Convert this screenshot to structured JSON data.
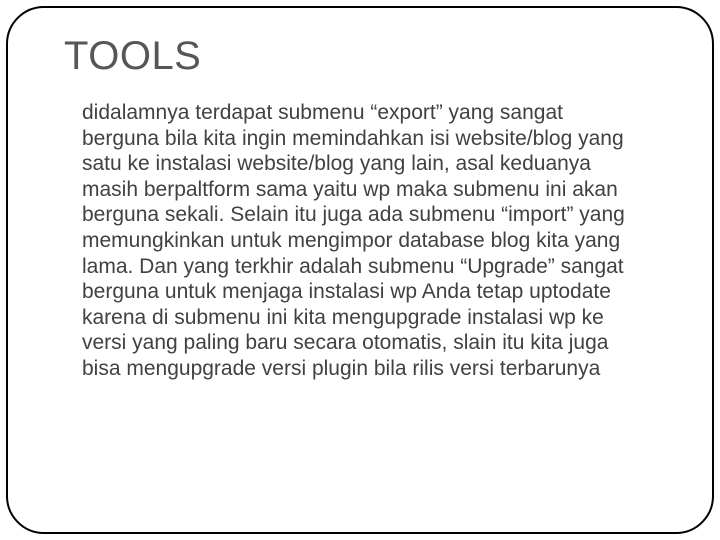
{
  "slide": {
    "title": "TOOLS",
    "body": "didalamnya terdapat submenu “export” yang sangat berguna bila kita ingin memindahkan isi website/blog yang satu ke instalasi website/blog yang lain, asal keduanya masih berpaltform sama yaitu wp maka submenu ini akan berguna sekali. Selain itu juga ada submenu “import” yang memungkinkan untuk mengimpor database blog kita yang lama.\nDan yang terkhir adalah submenu “Upgrade” sangat berguna untuk menjaga instalasi wp Anda tetap uptodate karena di submenu ini kita mengupgrade instalasi wp ke versi yang paling baru secara otomatis, slain itu kita juga bisa mengupgrade versi plugin bila rilis versi terbarunya"
  }
}
